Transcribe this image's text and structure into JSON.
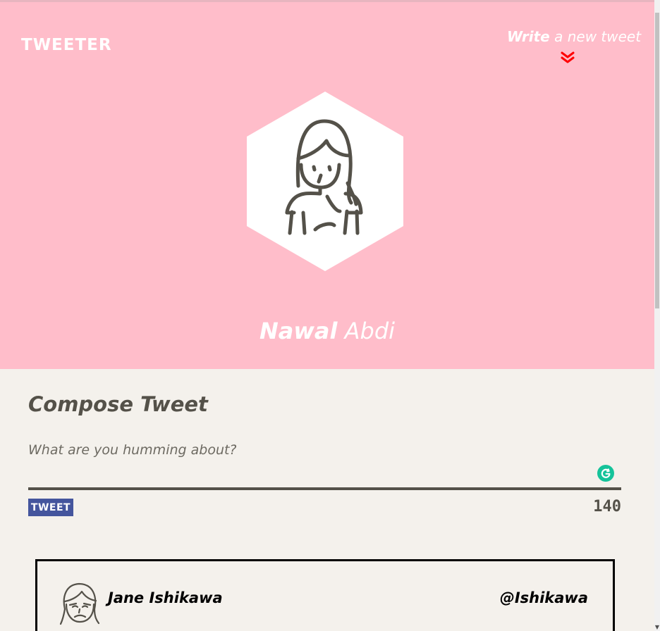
{
  "app": {
    "brand": "TWEETER"
  },
  "header": {
    "write_strong": "Write",
    "write_rest": "a new tweet",
    "write_icon": "chevron-double-down-icon"
  },
  "profile": {
    "first_name": "Nawal",
    "last_name": "Abdi",
    "avatar_icon": "woman-avatar-icon"
  },
  "compose": {
    "title": "Compose Tweet",
    "placeholder": "What are you humming about?",
    "value": "",
    "button_label": "TWEET",
    "char_count": "140",
    "assistant_icon": "grammarly-icon"
  },
  "tweets": [
    {
      "name": "Jane Ishikawa",
      "handle": "@Ishikawa",
      "avatar_icon": "sad-woman-avatar-icon"
    }
  ],
  "colors": {
    "hero_background": "#ffbdca",
    "page_background": "#f4f1ec",
    "text_dark": "#545149",
    "button_background": "#44559d",
    "chevron_accent": "#ff0000",
    "grammarly": "#15c39a"
  }
}
